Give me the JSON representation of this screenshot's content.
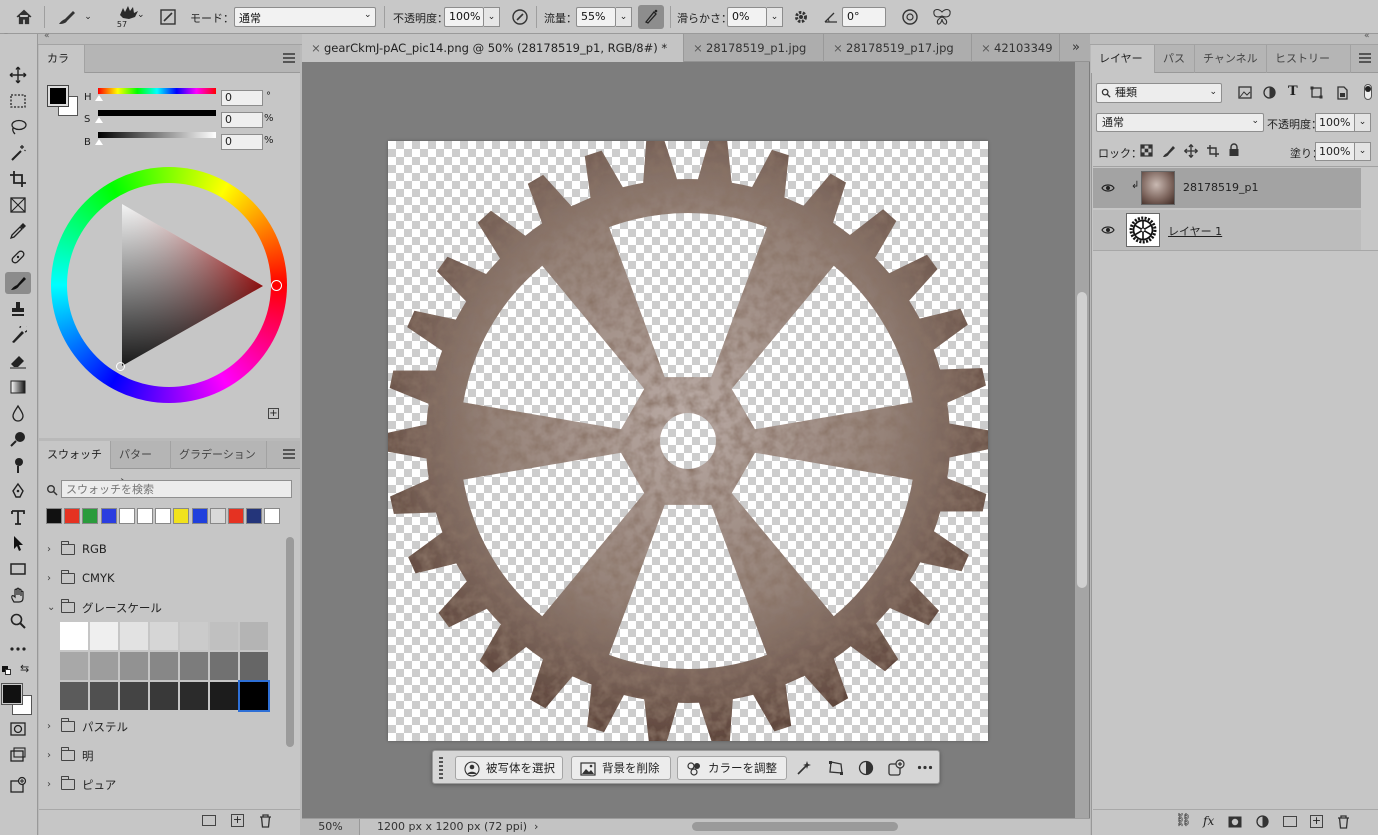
{
  "options_bar": {
    "brush_size": "57",
    "mode_label": "モード：",
    "mode_value": "通常",
    "opacity_label": "不透明度：",
    "opacity_value": "100%",
    "flow_label": "流量：",
    "flow_value": "55%",
    "smoothing_label": "滑らかさ：",
    "smoothing_value": "0%",
    "angle_value": "0°"
  },
  "color_panel": {
    "tab_label": "カラー",
    "h_label": "H",
    "h_value": "0",
    "h_unit": "°",
    "s_label": "S",
    "s_value": "0",
    "s_unit": "%",
    "b_label": "B",
    "b_value": "0",
    "b_unit": "%"
  },
  "swatches_panel": {
    "tabs": [
      "スウォッチ",
      "パターン",
      "グラデーション"
    ],
    "search_placeholder": "スウォッチを検索",
    "recent_colors": [
      "#111111",
      "#e53222",
      "#2a9b3c",
      "#2a3de0",
      "#ffffff",
      "#ffffff",
      "#ffffff",
      "#f1e21c",
      "#1f3fdc",
      "#d9d9d9",
      "#e53222",
      "#24357a",
      "#ffffff"
    ],
    "folders": [
      "RGB",
      "CMYK",
      "グレースケール",
      "パステル",
      "明",
      "ピュア"
    ],
    "grayscale_colors": [
      "#ffffff",
      "#efefef",
      "#e2e2e2",
      "#d6d6d6",
      "#cbcbcb",
      "#c0c0c0",
      "#b4b4b4",
      "#a8a8a8",
      "#9d9d9d",
      "#929292",
      "#878787",
      "#7c7c7c",
      "#717171",
      "#666666",
      "#5b5b5b",
      "#505050",
      "#444444",
      "#393939",
      "#2b2b2b",
      "#1c1c1c",
      "#000000"
    ]
  },
  "document_tabs": [
    {
      "label": "gearCkmJ-pAC_pic14.png @ 50% (28178519_p1, RGB/8#) *",
      "active": true
    },
    {
      "label": "28178519_p1.jpg",
      "active": false
    },
    {
      "label": "28178519_p17.jpg",
      "active": false
    },
    {
      "label": "42103349",
      "active": false
    }
  ],
  "context_bar": {
    "select_subject": "被写体を選択",
    "remove_bg": "背景を削除",
    "adjust_color": "カラーを調整"
  },
  "status_bar": {
    "zoom": "50%",
    "doc_size": "1200 px x 1200 px (72 ppi)"
  },
  "layers_panel": {
    "tabs": [
      "レイヤー",
      "パス",
      "チャンネル",
      "ヒストリー"
    ],
    "filter_kind": "種類",
    "blend_mode": "通常",
    "opacity_label": "不透明度：",
    "opacity_value": "100%",
    "lock_label": "ロック：",
    "fill_label": "塗り：",
    "fill_value": "100%",
    "layers": [
      {
        "name": "28178519_p1",
        "selected": true
      },
      {
        "name": "レイヤー 1",
        "selected": false
      }
    ]
  }
}
